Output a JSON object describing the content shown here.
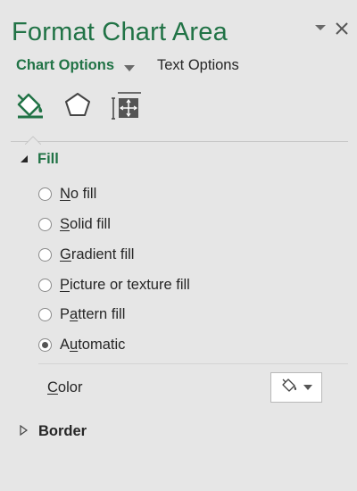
{
  "pane": {
    "title": "Format Chart Area"
  },
  "tabs": {
    "chart_options": "Chart Options",
    "text_options": "Text Options"
  },
  "icons": {
    "dropdown": "triangle-down-icon",
    "close": "close-x-icon",
    "fill_line": "paint-bucket-icon",
    "effects": "pentagon-icon",
    "size_properties": "size-properties-icon",
    "color": "paint-bucket-icon"
  },
  "fill": {
    "heading": "Fill",
    "options": [
      {
        "pre": "",
        "key": "N",
        "post": "o fill",
        "selected": false
      },
      {
        "pre": "",
        "key": "S",
        "post": "olid fill",
        "selected": false
      },
      {
        "pre": "",
        "key": "G",
        "post": "radient fill",
        "selected": false
      },
      {
        "pre": "",
        "key": "P",
        "post": "icture or texture fill",
        "selected": false
      },
      {
        "pre": "P",
        "key": "a",
        "post": "ttern fill",
        "selected": false
      },
      {
        "pre": "A",
        "key": "u",
        "post": "tomatic",
        "selected": true
      }
    ],
    "color_pre": "",
    "color_key": "C",
    "color_post": "olor"
  },
  "border": {
    "heading": "Border"
  },
  "colors": {
    "accent": "#217346",
    "background": "#e6e6e6"
  }
}
